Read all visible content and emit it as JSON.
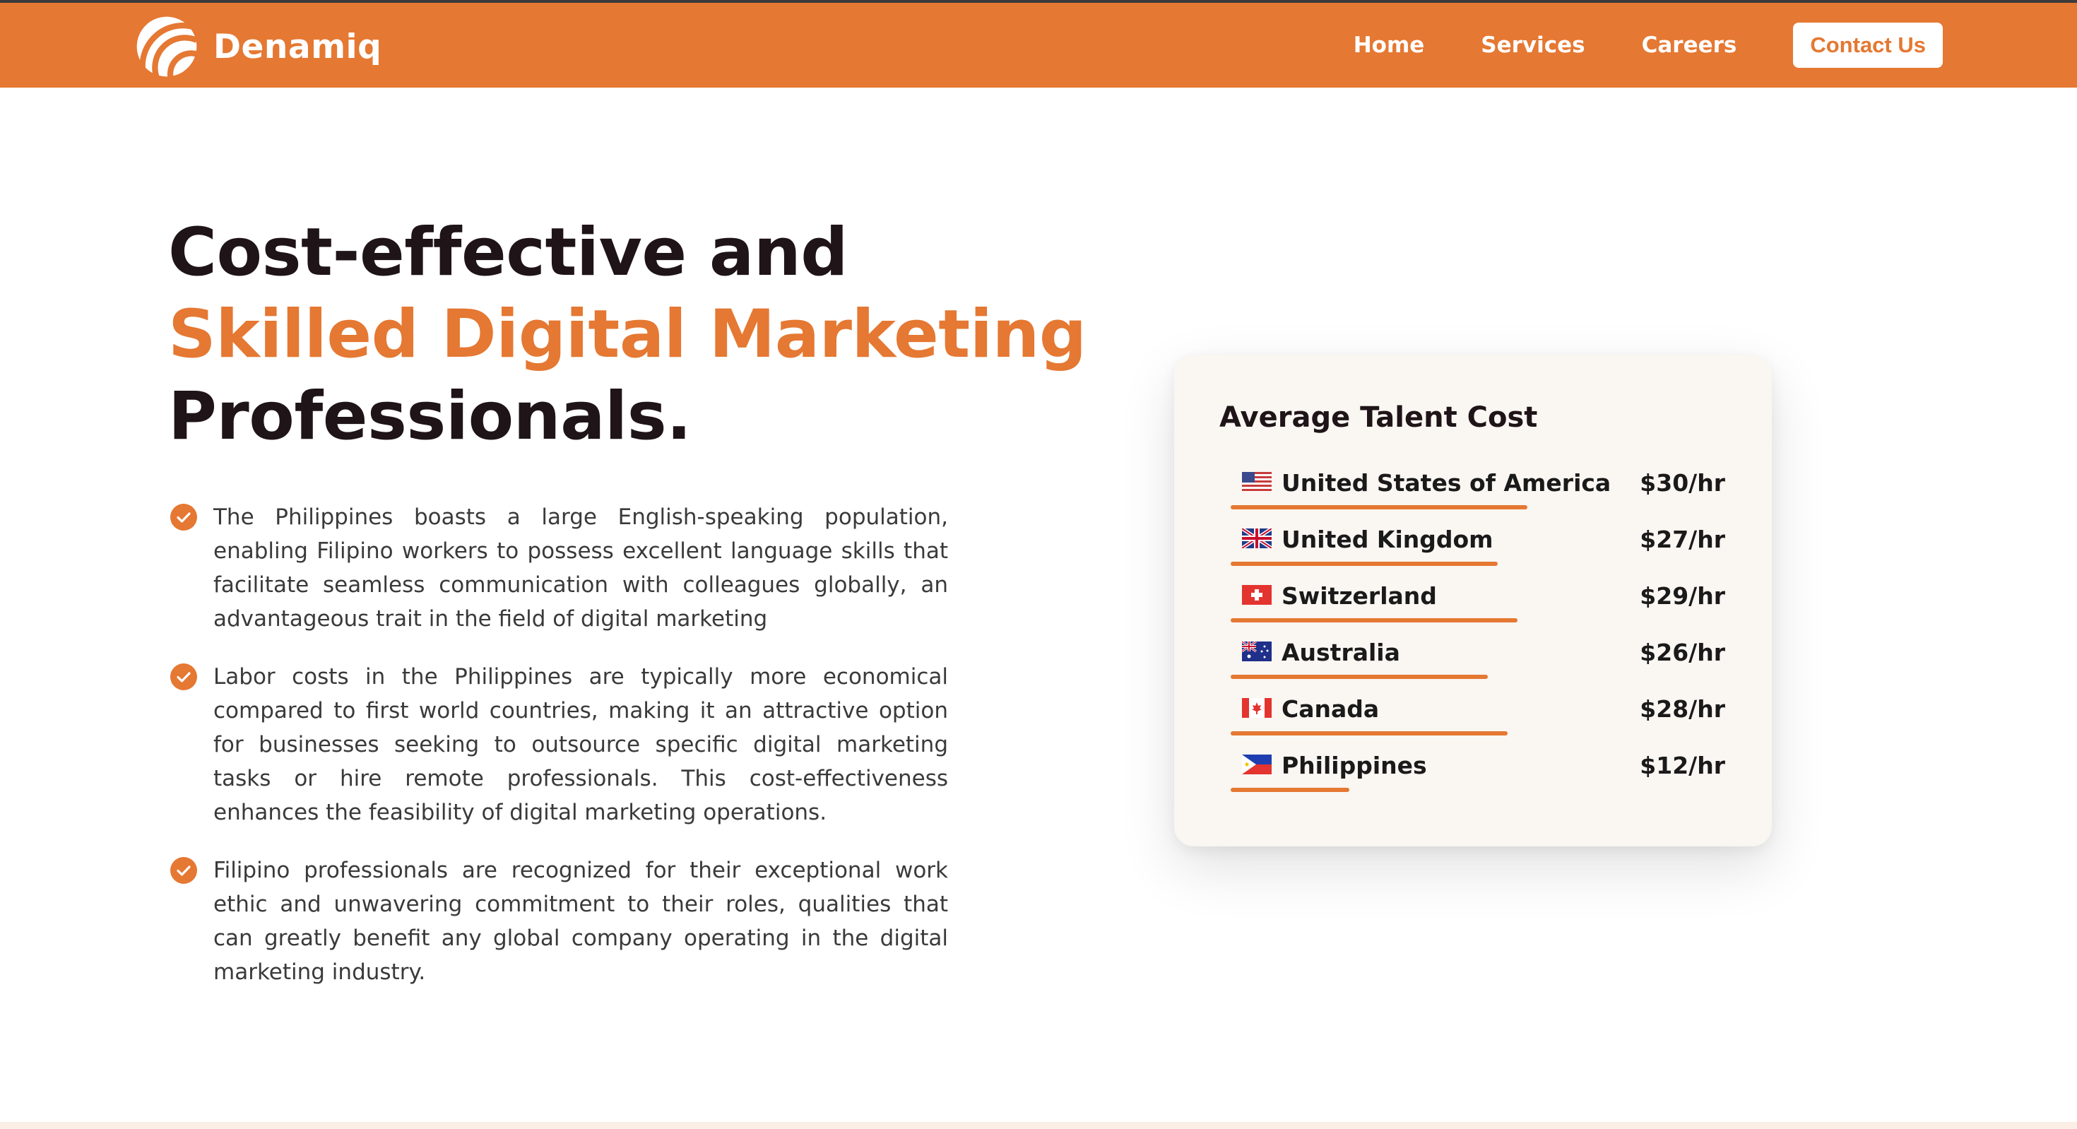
{
  "brand": {
    "name": "Denamiq",
    "color": "#e57832"
  },
  "nav": {
    "items": [
      "Home",
      "Services",
      "Careers"
    ],
    "cta": "Contact Us"
  },
  "hero": {
    "title_part1": "Cost-effective and ",
    "title_accent": "Skilled Digital Marketing",
    "title_part2": " Professionals."
  },
  "points": [
    "The Philippines boasts a large English-speaking population, enabling Filipino workers to possess excellent language skills that facilitate seamless communication with colleagues globally, an advantageous trait in the field of digital marketing",
    "Labor costs in the Philippines are typically more economical compared to first world countries, making it an attractive option for businesses seeking to outsource specific digital marketing tasks or hire remote professionals. This cost-effectiveness enhances the feasibility of digital marketing operations.",
    "Filipino professionals are recognized for their exceptional work ethic and unwavering commitment to their roles, qualities that can greatly benefit any global company operating in the digital marketing industry."
  ],
  "talent_card": {
    "title": "Average Talent Cost",
    "rows": [
      {
        "country": "United States of America",
        "price": "$30/hr",
        "rate": 30,
        "flag": "us-flag-icon"
      },
      {
        "country": "United Kingdom",
        "price": "$27/hr",
        "rate": 27,
        "flag": "uk-flag-icon"
      },
      {
        "country": "Switzerland",
        "price": "$29/hr",
        "rate": 29,
        "flag": "swiss-flag-icon"
      },
      {
        "country": "Australia",
        "price": "$26/hr",
        "rate": 26,
        "flag": "australia-flag-icon"
      },
      {
        "country": "Canada",
        "price": "$28/hr",
        "rate": 28,
        "flag": "canada-flag-icon"
      },
      {
        "country": "Philippines",
        "price": "$12/hr",
        "rate": 12,
        "flag": "philippines-flag-icon"
      }
    ]
  }
}
